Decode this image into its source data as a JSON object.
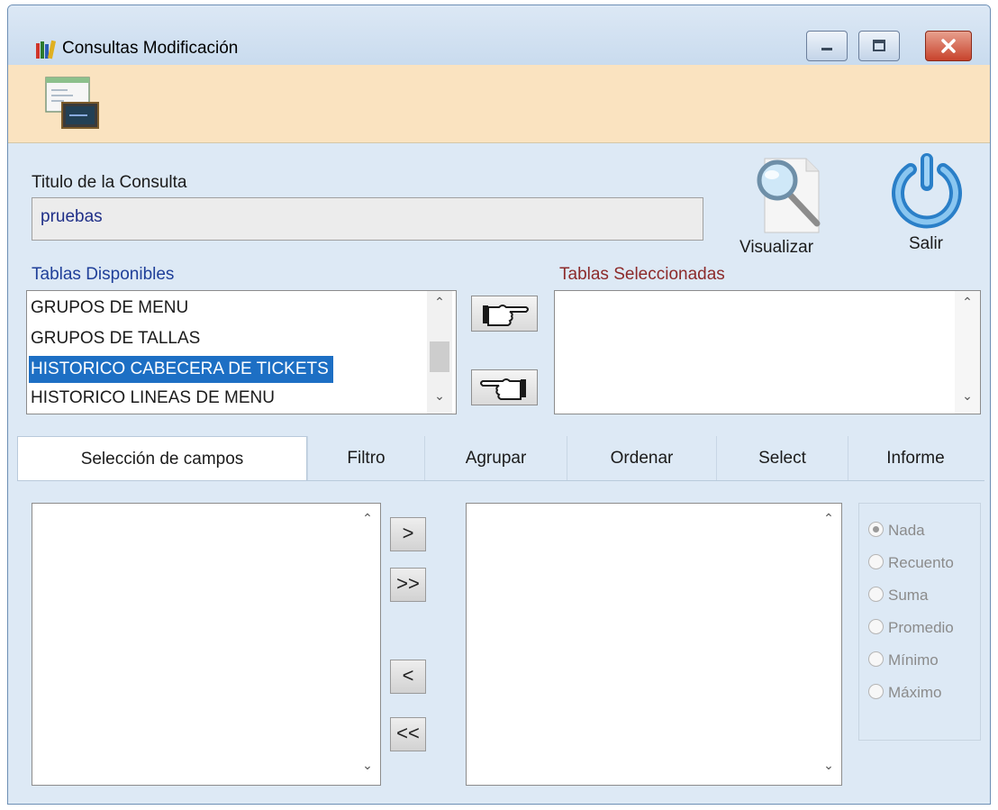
{
  "window": {
    "title": "Consultas Modificación",
    "app_icon": "books-icon",
    "controls": [
      "minimize-icon",
      "maximize-icon",
      "close-icon"
    ]
  },
  "toolbar": {
    "icon": "query-editor-icon"
  },
  "query": {
    "title_label": "Titulo de la Consulta",
    "title_value": "pruebas"
  },
  "actions": {
    "visualizar": {
      "label": "Visualizar",
      "icon": "magnifier-icon"
    },
    "salir": {
      "label": "Salir",
      "icon": "power-icon"
    }
  },
  "available_tables": {
    "label": "Tablas Disponibles",
    "items": [
      "GRUPOS DE MENU",
      "GRUPOS DE TALLAS",
      "HISTORICO CABECERA DE TICKETS",
      "HISTORICO LINEAS DE MENU"
    ],
    "selected_index": 2
  },
  "selected_tables": {
    "label": "Tablas Seleccionadas",
    "items": []
  },
  "transfer": {
    "add_icon": "hand-pointing-right-icon",
    "remove_icon": "hand-pointing-left-icon"
  },
  "tabs": [
    {
      "label": "Selección de campos",
      "active": true
    },
    {
      "label": "Filtro",
      "active": false
    },
    {
      "label": "Agrupar",
      "active": false
    },
    {
      "label": "Ordenar",
      "active": false
    },
    {
      "label": "Select",
      "active": false
    },
    {
      "label": "Informe",
      "active": false
    }
  ],
  "field_buttons": {
    "add": ">",
    "add_all": ">>",
    "remove": "<",
    "remove_all": "<<"
  },
  "aggregation": {
    "options": [
      "Nada",
      "Recuento",
      "Suma",
      "Promedio",
      "Mínimo",
      "Máximo"
    ],
    "selected": "Nada",
    "enabled": false
  },
  "colors": {
    "selection": "#1d6fc4",
    "toolbar_bg": "#fae3c0",
    "window_bg": "#dde9f5",
    "label_blue": "#1f3f99",
    "label_maroon": "#8c2a2a"
  }
}
